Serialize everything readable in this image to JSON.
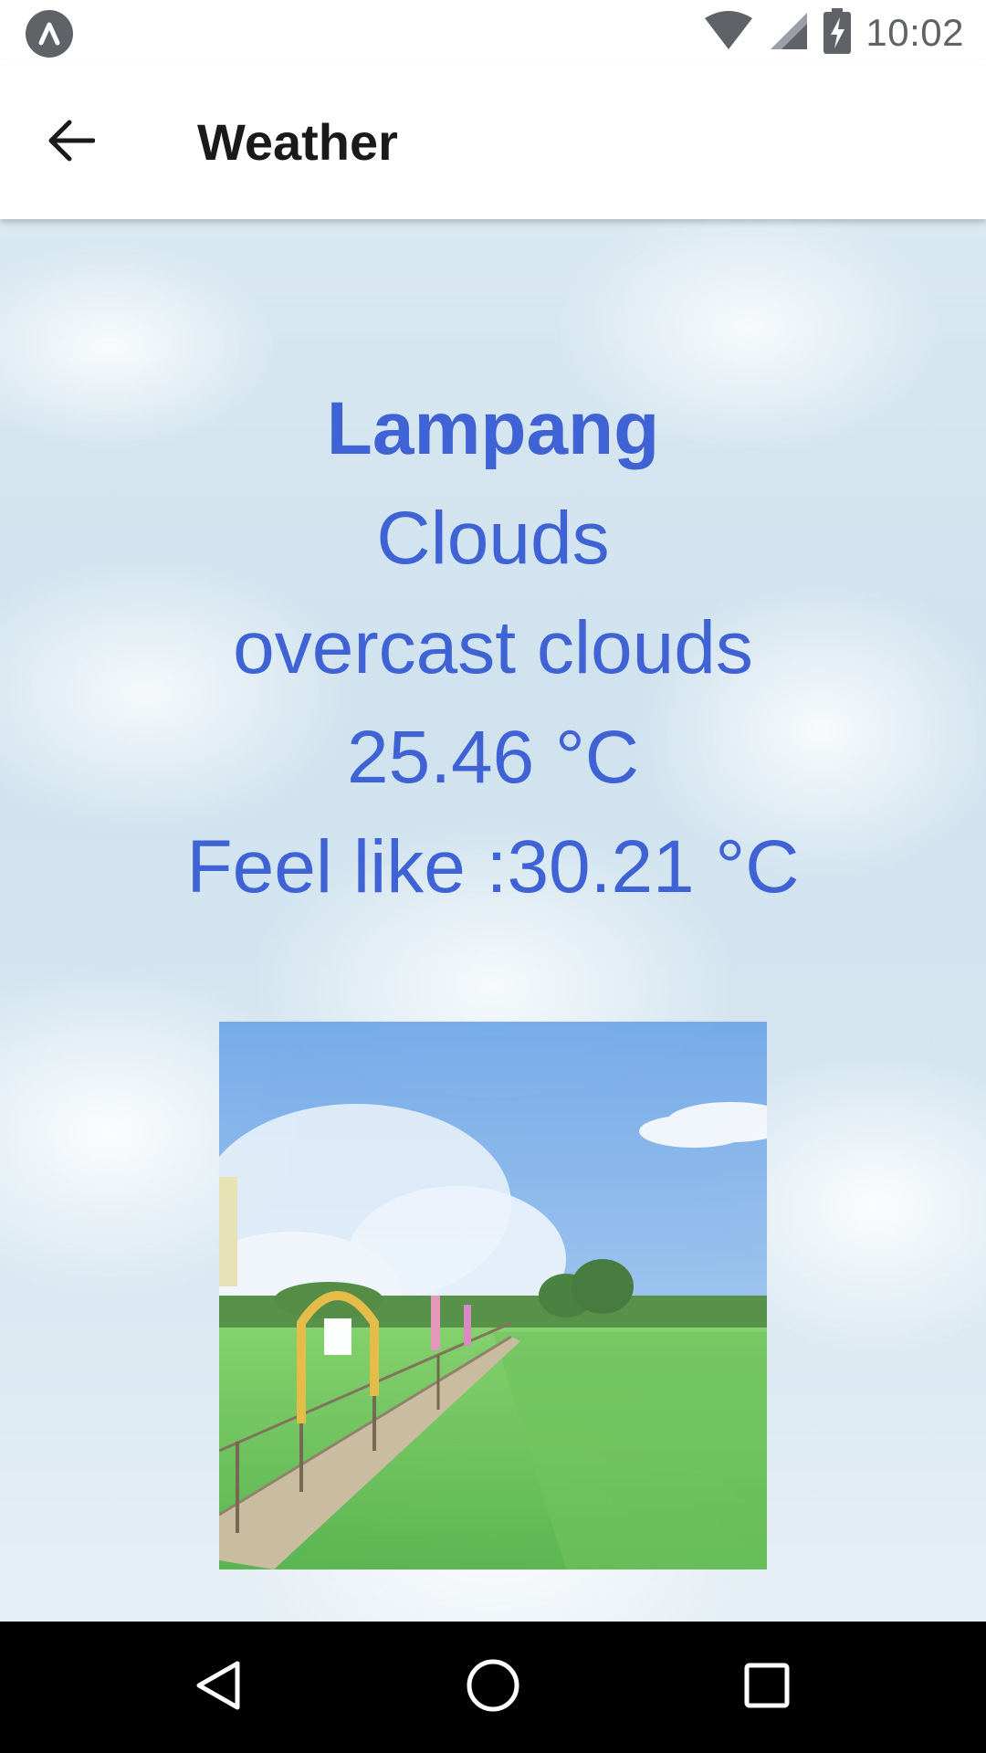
{
  "status_bar": {
    "time": "10:02",
    "icons": [
      "app-notification-icon",
      "wifi-icon",
      "signal-icon",
      "battery-charging-icon"
    ]
  },
  "app_bar": {
    "title": "Weather",
    "back_icon": "arrow-back-icon"
  },
  "weather": {
    "city": "Lampang",
    "main": "Clouds",
    "description": "overcast clouds",
    "temperature": "25.46 °C",
    "feels_like": "Feel like :30.21 °C"
  },
  "nav_bar": {
    "icons": [
      "back-triangle-icon",
      "home-circle-icon",
      "recents-square-icon"
    ]
  },
  "colors": {
    "accent_text": "#3f63d4",
    "status_gray": "#5f6368",
    "nav_background": "#000000"
  }
}
